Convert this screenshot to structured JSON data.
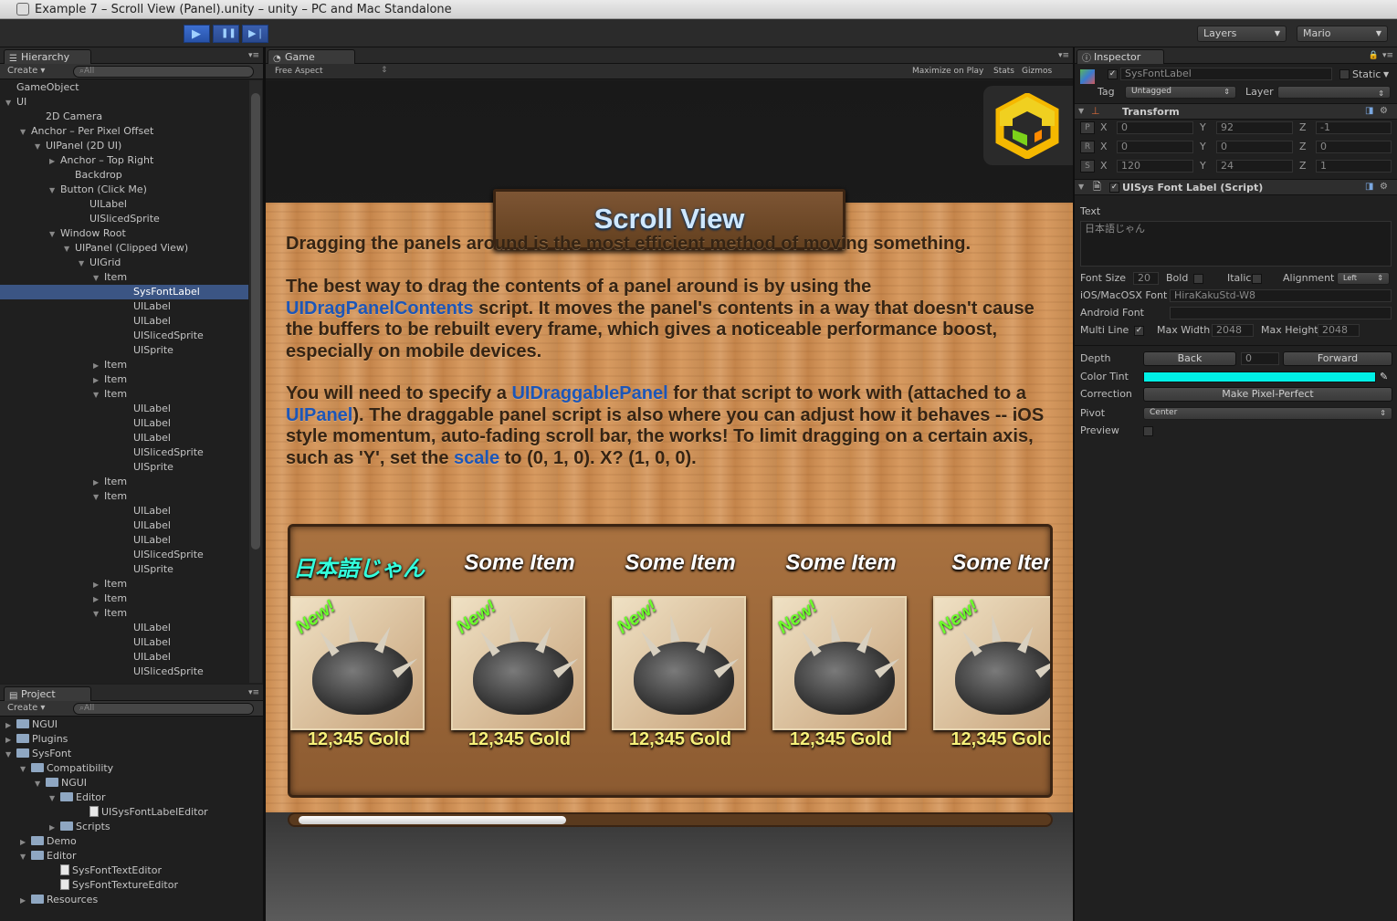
{
  "window": {
    "title": "Example 7 – Scroll View (Panel).unity – unity – PC and Mac Standalone"
  },
  "toolbar": {
    "play": "▶",
    "pause": "❚❚",
    "step": "▶❘",
    "layers": "Layers",
    "layout": "Mario"
  },
  "hierarchy": {
    "tab": "Hierarchy",
    "create": "Create ▾",
    "search": "All",
    "rows": [
      {
        "label": "GameObject",
        "indent": 0,
        "arrow": ""
      },
      {
        "label": "UI",
        "indent": 0,
        "arrow": "▼"
      },
      {
        "label": "2D Camera",
        "indent": 2,
        "arrow": ""
      },
      {
        "label": "Anchor – Per Pixel Offset",
        "indent": 1,
        "arrow": "▼"
      },
      {
        "label": "UIPanel (2D UI)",
        "indent": 2,
        "arrow": "▼"
      },
      {
        "label": "Anchor – Top Right",
        "indent": 3,
        "arrow": "▶"
      },
      {
        "label": "Backdrop",
        "indent": 4,
        "arrow": ""
      },
      {
        "label": "Button (Click Me)",
        "indent": 3,
        "arrow": "▼"
      },
      {
        "label": "UILabel",
        "indent": 5,
        "arrow": ""
      },
      {
        "label": "UISlicedSprite",
        "indent": 5,
        "arrow": ""
      },
      {
        "label": "Window Root",
        "indent": 3,
        "arrow": "▼"
      },
      {
        "label": "UIPanel (Clipped View)",
        "indent": 4,
        "arrow": "▼"
      },
      {
        "label": "UIGrid",
        "indent": 5,
        "arrow": "▼"
      },
      {
        "label": "Item",
        "indent": 6,
        "arrow": "▼"
      },
      {
        "label": "SysFontLabel",
        "indent": 8,
        "arrow": "",
        "selected": true
      },
      {
        "label": "UILabel",
        "indent": 8,
        "arrow": ""
      },
      {
        "label": "UILabel",
        "indent": 8,
        "arrow": ""
      },
      {
        "label": "UISlicedSprite",
        "indent": 8,
        "arrow": ""
      },
      {
        "label": "UISprite",
        "indent": 8,
        "arrow": ""
      },
      {
        "label": "Item",
        "indent": 6,
        "arrow": "▶"
      },
      {
        "label": "Item",
        "indent": 6,
        "arrow": "▶"
      },
      {
        "label": "Item",
        "indent": 6,
        "arrow": "▼"
      },
      {
        "label": "UILabel",
        "indent": 8,
        "arrow": ""
      },
      {
        "label": "UILabel",
        "indent": 8,
        "arrow": ""
      },
      {
        "label": "UILabel",
        "indent": 8,
        "arrow": ""
      },
      {
        "label": "UISlicedSprite",
        "indent": 8,
        "arrow": ""
      },
      {
        "label": "UISprite",
        "indent": 8,
        "arrow": ""
      },
      {
        "label": "Item",
        "indent": 6,
        "arrow": "▶"
      },
      {
        "label": "Item",
        "indent": 6,
        "arrow": "▼"
      },
      {
        "label": "UILabel",
        "indent": 8,
        "arrow": ""
      },
      {
        "label": "UILabel",
        "indent": 8,
        "arrow": ""
      },
      {
        "label": "UILabel",
        "indent": 8,
        "arrow": ""
      },
      {
        "label": "UISlicedSprite",
        "indent": 8,
        "arrow": ""
      },
      {
        "label": "UISprite",
        "indent": 8,
        "arrow": ""
      },
      {
        "label": "Item",
        "indent": 6,
        "arrow": "▶"
      },
      {
        "label": "Item",
        "indent": 6,
        "arrow": "▶"
      },
      {
        "label": "Item",
        "indent": 6,
        "arrow": "▼"
      },
      {
        "label": "UILabel",
        "indent": 8,
        "arrow": ""
      },
      {
        "label": "UILabel",
        "indent": 8,
        "arrow": ""
      },
      {
        "label": "UILabel",
        "indent": 8,
        "arrow": ""
      },
      {
        "label": "UISlicedSprite",
        "indent": 8,
        "arrow": ""
      }
    ]
  },
  "project": {
    "tab": "Project",
    "create": "Create ▾",
    "search": "All",
    "rows": [
      {
        "label": "NGUI",
        "indent": 0,
        "arrow": "▶",
        "icon": "folder"
      },
      {
        "label": "Plugins",
        "indent": 0,
        "arrow": "▶",
        "icon": "folder"
      },
      {
        "label": "SysFont",
        "indent": 0,
        "arrow": "▼",
        "icon": "folder"
      },
      {
        "label": "Compatibility",
        "indent": 1,
        "arrow": "▼",
        "icon": "folder"
      },
      {
        "label": "NGUI",
        "indent": 2,
        "arrow": "▼",
        "icon": "folder"
      },
      {
        "label": "Editor",
        "indent": 3,
        "arrow": "▼",
        "icon": "folder"
      },
      {
        "label": "UISysFontLabelEditor",
        "indent": 5,
        "arrow": "",
        "icon": "doc"
      },
      {
        "label": "Scripts",
        "indent": 3,
        "arrow": "▶",
        "icon": "folder"
      },
      {
        "label": "Demo",
        "indent": 1,
        "arrow": "▶",
        "icon": "folder"
      },
      {
        "label": "Editor",
        "indent": 1,
        "arrow": "▼",
        "icon": "folder"
      },
      {
        "label": "SysFontTextEditor",
        "indent": 3,
        "arrow": "",
        "icon": "doc"
      },
      {
        "label": "SysFontTextureEditor",
        "indent": 3,
        "arrow": "",
        "icon": "doc"
      },
      {
        "label": "Resources",
        "indent": 1,
        "arrow": "▶",
        "icon": "folder"
      }
    ]
  },
  "game": {
    "tab": "Game",
    "aspect": "Free Aspect",
    "maximize": "Maximize on Play",
    "stats": "Stats",
    "gizmos": "Gizmos",
    "title": "Scroll View",
    "p1": "Dragging the panels around is the most efficient method of moving something.",
    "p2a": "The best way to drag the contents of a panel around is by using the ",
    "p2link": "UIDragPanelContents",
    "p2b": " script. It moves the panel's contents in a way that doesn't cause the buffers to be rebuilt every frame, which gives a noticeable performance boost, especially on mobile devices.",
    "p3a": "You will need to specify a ",
    "p3link1": "UIDraggablePanel",
    "p3b": " for that script to work with (attached to a ",
    "p3link2": "UIPanel",
    "p3c": "). The draggable panel script is also where you can adjust how it behaves -- iOS style momentum, auto-fading scroll bar, the works! To limit dragging on a certain axis, such as 'Y', set the ",
    "p3link3": "scale",
    "p3d": " to (0, 1, 0). X? (1, 0, 0).",
    "items": [
      {
        "title": "日本語じゃん",
        "jp": true,
        "new": "New!",
        "price": "12,345 Gold"
      },
      {
        "title": "Some Item",
        "jp": false,
        "new": "New!",
        "price": "12,345 Gold"
      },
      {
        "title": "Some Item",
        "jp": false,
        "new": "New!",
        "price": "12,345 Gold"
      },
      {
        "title": "Some Item",
        "jp": false,
        "new": "New!",
        "price": "12,345 Gold"
      },
      {
        "title": "Some Iter",
        "jp": false,
        "new": "New!",
        "price": "12,345 Golc"
      }
    ],
    "scroll_fraction": 0.36
  },
  "inspector": {
    "tab": "Inspector",
    "object_name": "SysFontLabel",
    "static": "Static",
    "tag_label": "Tag",
    "tag_value": "Untagged",
    "layer_label": "Layer",
    "transform": {
      "header": "Transform",
      "rows": [
        {
          "key": "P",
          "x": "0",
          "y": "92",
          "z": "-1"
        },
        {
          "key": "R",
          "x": "0",
          "y": "0",
          "z": "0"
        },
        {
          "key": "S",
          "x": "120",
          "y": "24",
          "z": "1"
        }
      ]
    },
    "script": {
      "header": "UISys Font Label (Script)",
      "text_label": "Text",
      "text_value": "日本語じゃん",
      "font_size_label": "Font Size",
      "font_size": "20",
      "bold_label": "Bold",
      "italic_label": "Italic",
      "alignment_label": "Alignment",
      "alignment": "Left",
      "ios_font_label": "iOS/MacOSX Font",
      "ios_font": "HiraKakuStd-W8",
      "android_font_label": "Android Font",
      "multiline_label": "Multi Line",
      "max_width_label": "Max Width",
      "max_width": "2048",
      "max_height_label": "Max Height",
      "max_height": "2048"
    },
    "widget": {
      "depth_label": "Depth",
      "back": "Back",
      "depth": "0",
      "forward": "Forward",
      "color_tint_label": "Color Tint",
      "color_tint": "#00f0e6",
      "correction_label": "Correction",
      "make_pixel_perfect": "Make Pixel-Perfect",
      "pivot_label": "Pivot",
      "pivot": "Center",
      "preview_label": "Preview"
    }
  }
}
